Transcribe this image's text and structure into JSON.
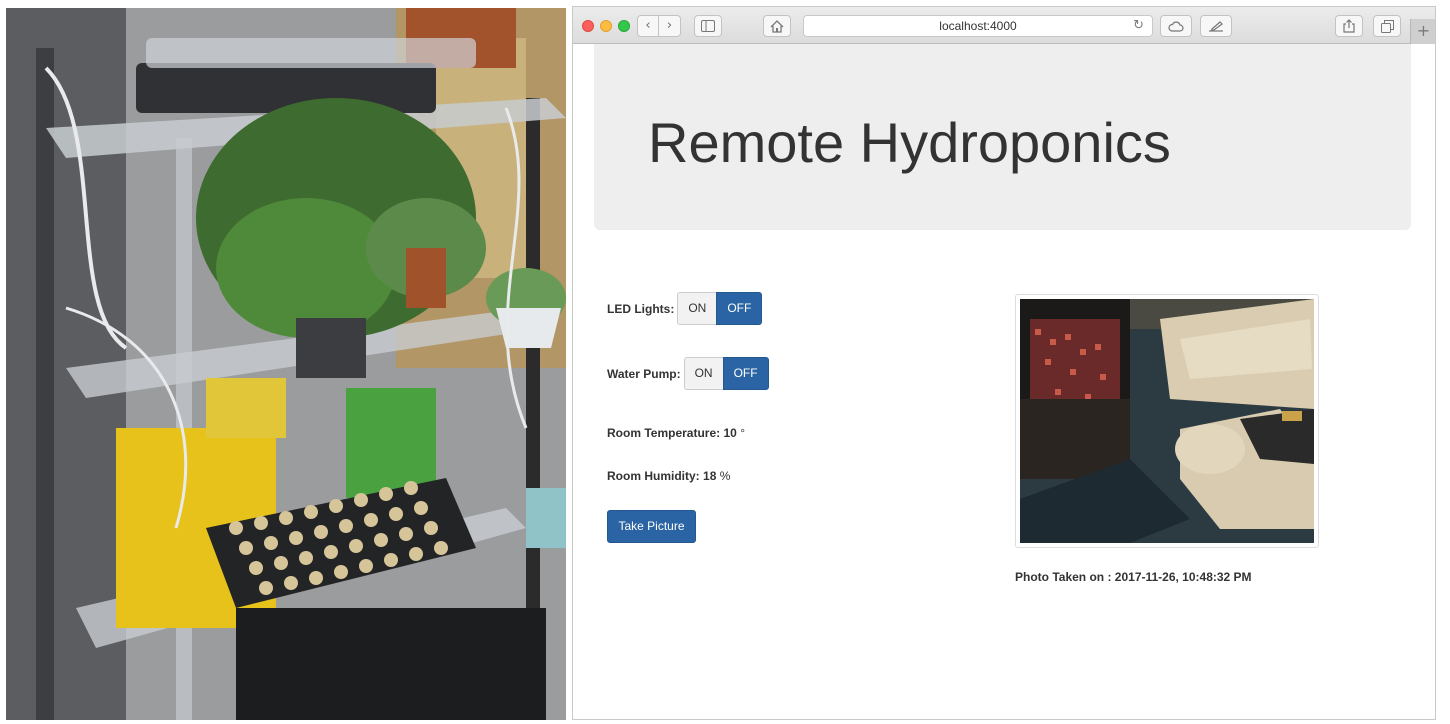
{
  "browser": {
    "url": "localhost:4000",
    "toolbar": {
      "back_glyph": "‹",
      "forward_glyph": "›",
      "reload_glyph": "↻",
      "new_tab_glyph": "+"
    }
  },
  "page": {
    "title": "Remote Hydroponics",
    "led_lights": {
      "label": "LED Lights:",
      "on_label": "ON",
      "off_label": "OFF",
      "active": "OFF"
    },
    "water_pump": {
      "label": "Water Pump:",
      "on_label": "ON",
      "off_label": "OFF",
      "active": "OFF"
    },
    "room_temperature": {
      "label": "Room Temperature:",
      "value": "10",
      "unit": "°"
    },
    "room_humidity": {
      "label": "Room Humidity:",
      "value": "18",
      "unit": "%"
    },
    "take_picture_label": "Take Picture",
    "photo_taken": {
      "label": "Photo Taken on :",
      "value": "2017-11-26, 10:48:32 PM"
    }
  },
  "icons": [
    "back-icon",
    "forward-icon",
    "sidebar-icon",
    "home-icon",
    "reload-icon",
    "cloud-icon",
    "edit-icon",
    "share-icon",
    "tabs-icon",
    "new-tab-icon"
  ],
  "colors": {
    "primary": "#2a64a4",
    "jumbotron": "#eeeeee",
    "text": "#333333"
  }
}
